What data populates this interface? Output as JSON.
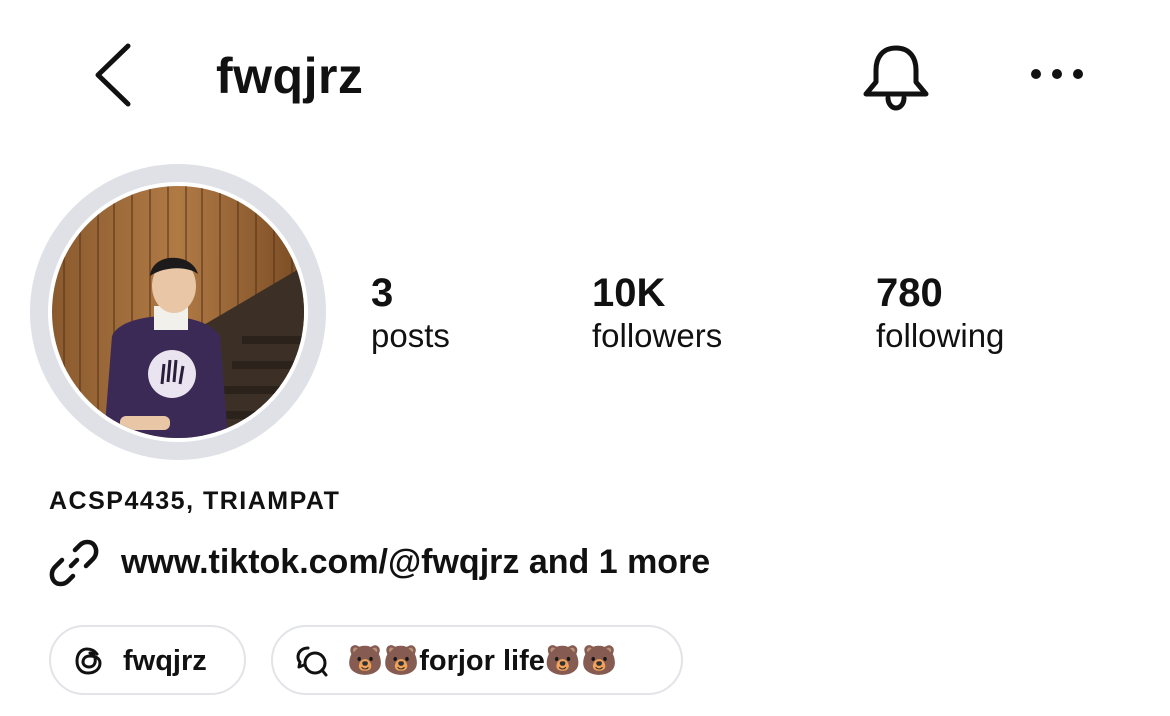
{
  "header": {
    "username": "fwqjrz",
    "back_icon": "chevron-left-icon",
    "notification_icon": "bell-icon",
    "more_icon": "more-horizontal-icon"
  },
  "profile": {
    "avatar_alt": "profile photo"
  },
  "stats": {
    "posts": {
      "value": "3",
      "label": "posts"
    },
    "followers": {
      "value": "10K",
      "label": "followers"
    },
    "following": {
      "value": "780",
      "label": "following"
    }
  },
  "bio": {
    "name": "ACSP4435, TRIAMPAT",
    "link_icon": "link-icon",
    "link_text": "www.tiktok.com/@fwqjrz and 1 more"
  },
  "chips": {
    "threads": {
      "icon": "threads-icon",
      "label": "fwqjrz"
    },
    "note": {
      "icon": "note-bubble-icon",
      "label": "🐻🐻forjor life🐻🐻"
    }
  },
  "colors": {
    "text": "#111111",
    "ring": "#dfe1e7",
    "chip_border": "#e3e4e8",
    "background": "#ffffff"
  }
}
